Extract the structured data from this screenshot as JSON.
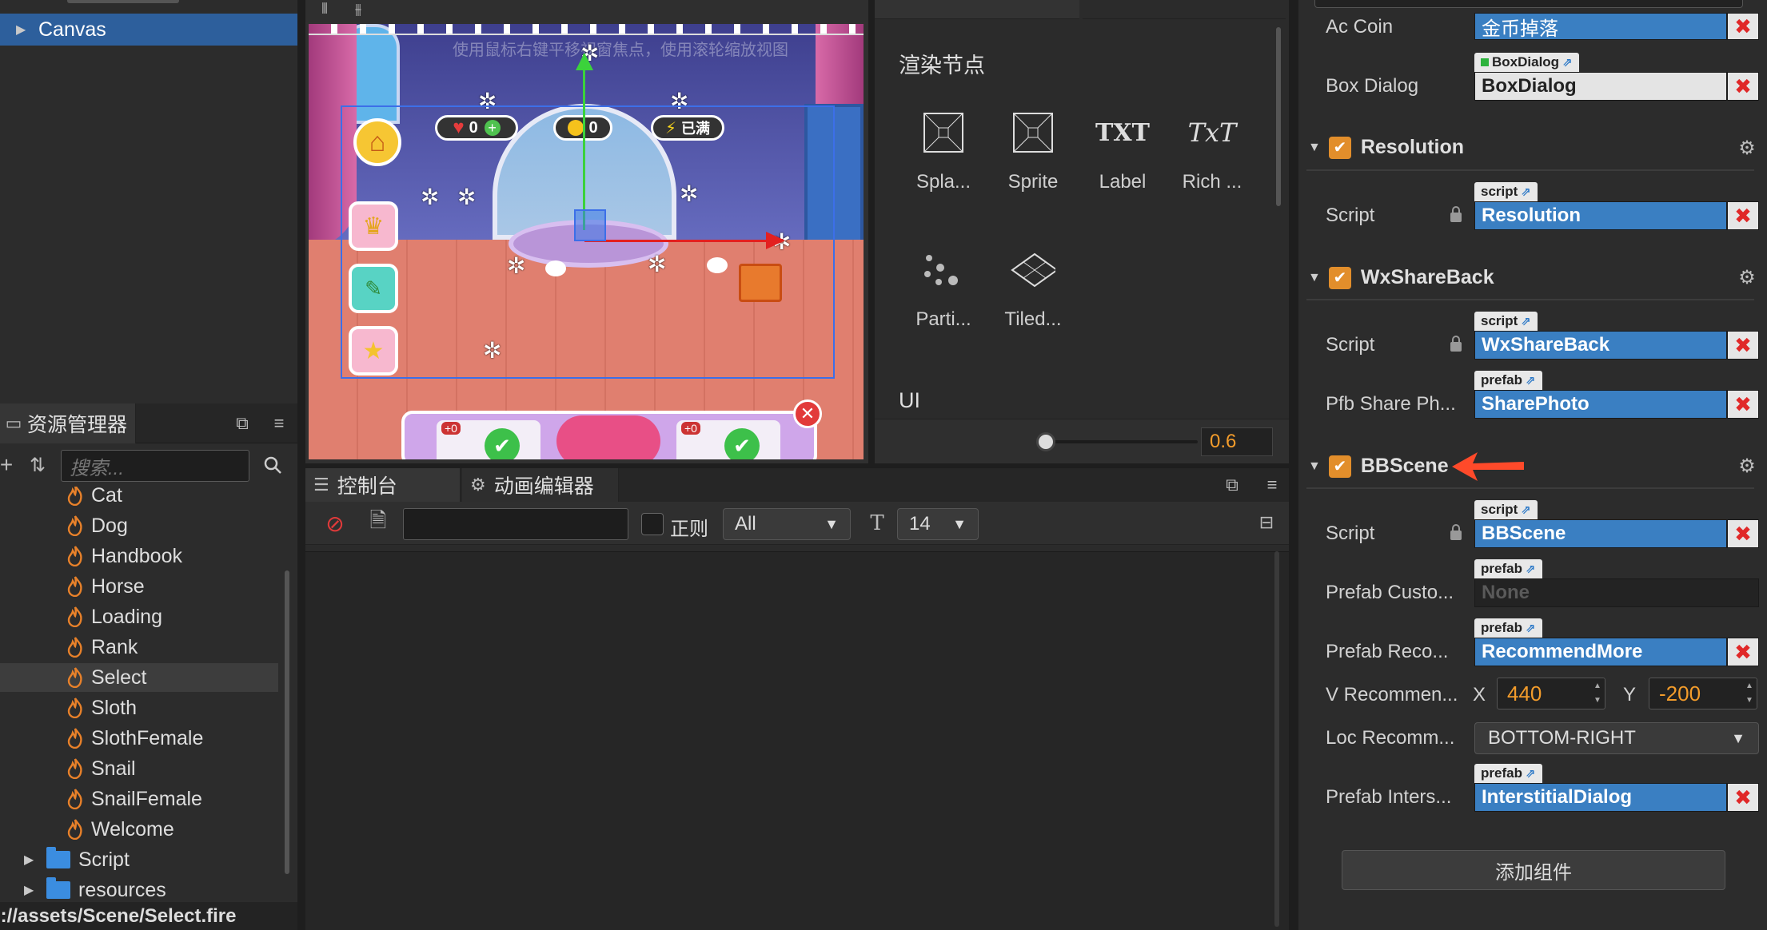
{
  "hierarchy": {
    "selected_node": "Canvas"
  },
  "assets": {
    "title": "资源管理器",
    "search_placeholder": "搜索...",
    "items": [
      {
        "label": "Cat"
      },
      {
        "label": "Dog"
      },
      {
        "label": "Handbook"
      },
      {
        "label": "Horse"
      },
      {
        "label": "Loading"
      },
      {
        "label": "Rank"
      },
      {
        "label": "Select"
      },
      {
        "label": "Sloth"
      },
      {
        "label": "SlothFemale"
      },
      {
        "label": "Snail"
      },
      {
        "label": "SnailFemale"
      },
      {
        "label": "Welcome"
      }
    ],
    "folders": [
      {
        "label": "Script"
      },
      {
        "label": "resources"
      }
    ],
    "selected": "Select"
  },
  "status_bar": {
    "path": "b://assets/Scene/Select.fire"
  },
  "scene": {
    "hint": "使用鼠标右键平移视窗焦点，使用滚轮缩放视图",
    "hud": {
      "hearts": "0",
      "coins": "0",
      "energy": "已满"
    },
    "bottom_badges": [
      "+0",
      "+0"
    ]
  },
  "node_library": {
    "section_render": "渲染节点",
    "items": [
      {
        "label": "Spla...",
        "icon": "splash-icon"
      },
      {
        "label": "Sprite",
        "icon": "sprite-icon"
      },
      {
        "label": "Label",
        "icon": "label-icon",
        "glyph": "TXT"
      },
      {
        "label": "Rich ...",
        "icon": "richtext-icon",
        "glyph": "TxT"
      },
      {
        "label": "Parti...",
        "icon": "particle-icon"
      },
      {
        "label": "Tiled...",
        "icon": "tiledmap-icon"
      }
    ],
    "section_ui": "UI",
    "zoom_value": "0.6"
  },
  "console": {
    "tabs": [
      {
        "label": "控制台"
      },
      {
        "label": "动画编辑器"
      }
    ],
    "regex_label": "正则",
    "level_value": "All",
    "font_size_value": "14"
  },
  "inspector": {
    "ac_coin": {
      "label": "Ac Coin",
      "value": "金币掉落"
    },
    "box_dialog": {
      "label": "Box Dialog",
      "tag": "BoxDialog",
      "value": "BoxDialog"
    },
    "resolution": {
      "title": "Resolution",
      "script_label": "Script",
      "tag": "script",
      "value": "Resolution"
    },
    "wxshareback": {
      "title": "WxShareBack",
      "script_label": "Script",
      "script_tag": "script",
      "script_value": "WxShareBack",
      "pfb_label": "Pfb Share Ph...",
      "pfb_tag": "prefab",
      "pfb_value": "SharePhoto"
    },
    "bbscene": {
      "title": "BBScene",
      "script_label": "Script",
      "script_tag": "script",
      "script_value": "BBScene",
      "custom_label": "Prefab Custo...",
      "custom_tag": "prefab",
      "custom_value": "None",
      "recom_label": "Prefab Reco...",
      "recom_tag": "prefab",
      "recom_value": "RecommendMore",
      "vrec_label": "V Recommen...",
      "x_label": "X",
      "x_value": "440",
      "y_label": "Y",
      "y_value": "-200",
      "loc_label": "Loc Recomm...",
      "loc_value": "BOTTOM-RIGHT",
      "inter_label": "Prefab Inters...",
      "inter_tag": "prefab",
      "inter_value": "InterstitialDialog"
    },
    "add_component": "添加组件"
  },
  "colors": {
    "accent": "#e28e2b",
    "selection": "#2d5f9c",
    "field_blue": "#3a7fc2",
    "remove_red": "#e02828",
    "value_orange": "#f39c2b"
  }
}
